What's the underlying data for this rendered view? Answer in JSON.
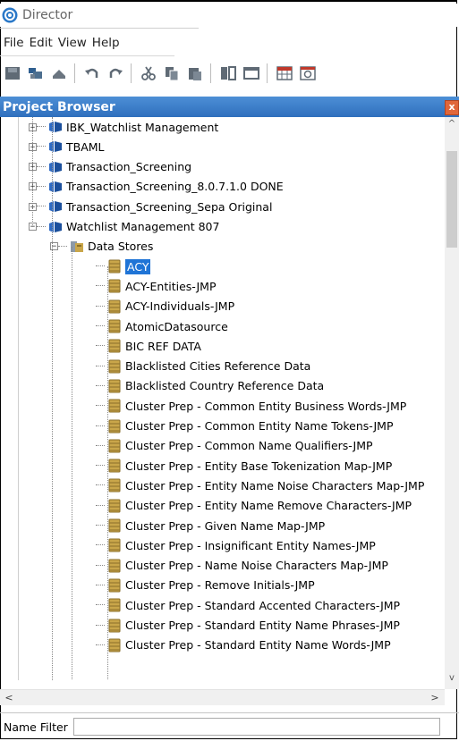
{
  "window": {
    "title": "Director"
  },
  "menu": [
    "File",
    "Edit",
    "View",
    "Help"
  ],
  "toolbar": [
    "save-icon",
    "cut-project-icon",
    "remove-icon",
    "undo-icon",
    "redo-icon",
    "scissors-icon",
    "copy-icon",
    "paste-icon",
    "split-view-icon",
    "window-icon",
    "table-icon",
    "image-icon"
  ],
  "panel": {
    "title": "Project Browser",
    "close": "x"
  },
  "tree": {
    "projects": [
      {
        "label": "IBK_Watchlist Management",
        "state": "+"
      },
      {
        "label": "TBAML",
        "state": "+"
      },
      {
        "label": "Transaction_Screening",
        "state": "+"
      },
      {
        "label": "Transaction_Screening_8.0.7.1.0 DONE",
        "state": "+"
      },
      {
        "label": "Transaction_Screening_Sepa Original",
        "state": "+"
      },
      {
        "label": "Watchlist Management 807",
        "state": "-"
      }
    ],
    "folder": {
      "label": "Data Stores",
      "state": "-"
    },
    "stores": [
      "ACY",
      "ACY-Entities-JMP",
      "ACY-Individuals-JMP",
      "AtomicDatasource",
      "BIC REF DATA",
      "Blacklisted Cities Reference Data",
      "Blacklisted Country Reference Data",
      "Cluster Prep - Common Entity Business Words-JMP",
      "Cluster Prep - Common Entity Name Tokens-JMP",
      "Cluster Prep - Common Name Qualifiers-JMP",
      "Cluster Prep - Entity Base Tokenization Map-JMP",
      "Cluster Prep - Entity Name Noise Characters Map-JMP",
      "Cluster Prep - Entity Name Remove Characters-JMP",
      "Cluster Prep - Given Name Map-JMP",
      "Cluster Prep - Insignificant Entity Names-JMP",
      "Cluster Prep - Name Noise Characters Map-JMP",
      "Cluster Prep - Remove Initials-JMP",
      "Cluster Prep - Standard Accented Characters-JMP",
      "Cluster Prep - Standard Entity Name Phrases-JMP",
      "Cluster Prep - Standard Entity Name Words-JMP"
    ],
    "selected_index": 0
  },
  "scroll": {
    "up": "^",
    "down": "v",
    "left": "<",
    "right": ">"
  },
  "filter": {
    "label": "Name Filter",
    "value": ""
  },
  "colors": {
    "panel_header": "#3b7dc9",
    "selection": "#1f74d6",
    "close_button": "#e0663a"
  }
}
